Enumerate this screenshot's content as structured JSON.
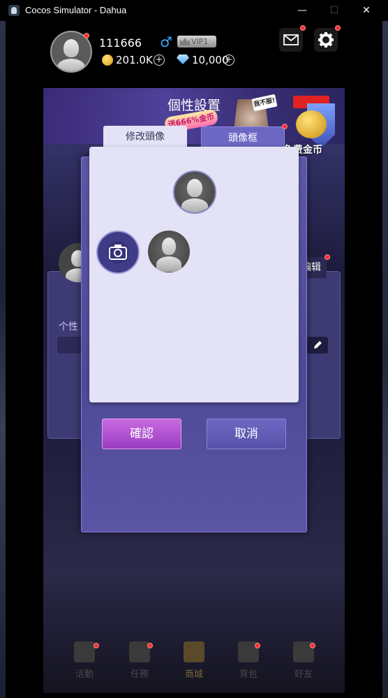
{
  "window": {
    "title": "Cocos Simulator - Dahua",
    "min_label": "—",
    "max_label": "☐",
    "close_label": "✕"
  },
  "profile": {
    "username": "111666",
    "gender_symbol": "♂",
    "vip_label": "VIP1",
    "coins": "201.0K",
    "gems": "10,000",
    "plus_symbol": "+",
    "mail_icon": "mail-icon",
    "settings_icon": "gear-icon"
  },
  "banner": {
    "title": "個性設置",
    "promo_text": "送666%金币",
    "tag_text": "我不服!",
    "free_gold_label": "免费金币"
  },
  "background_panel": {
    "signature_label": "个性",
    "edit_label": "编辑",
    "edit_icon": "pencil-icon"
  },
  "dialog": {
    "tabs": [
      {
        "label": "修改頭像",
        "active": true
      },
      {
        "label": "頭像框",
        "active": false
      }
    ],
    "camera_icon": "camera-icon",
    "confirm_label": "確認",
    "cancel_label": "取消"
  },
  "bottom_nav": [
    {
      "label": "活動",
      "icon": "calendar-star-icon"
    },
    {
      "label": "任務",
      "icon": "task-check-icon"
    },
    {
      "label": "商城",
      "icon": "shopping-cart-icon",
      "active": true
    },
    {
      "label": "背包",
      "icon": "backpack-icon"
    },
    {
      "label": "好友",
      "icon": "friends-icon"
    }
  ],
  "colors": {
    "accent_purple": "#5d58a6",
    "confirm_magenta": "#b04fd0",
    "notification_red": "#e33333",
    "gender_blue": "#3ea7ff"
  }
}
